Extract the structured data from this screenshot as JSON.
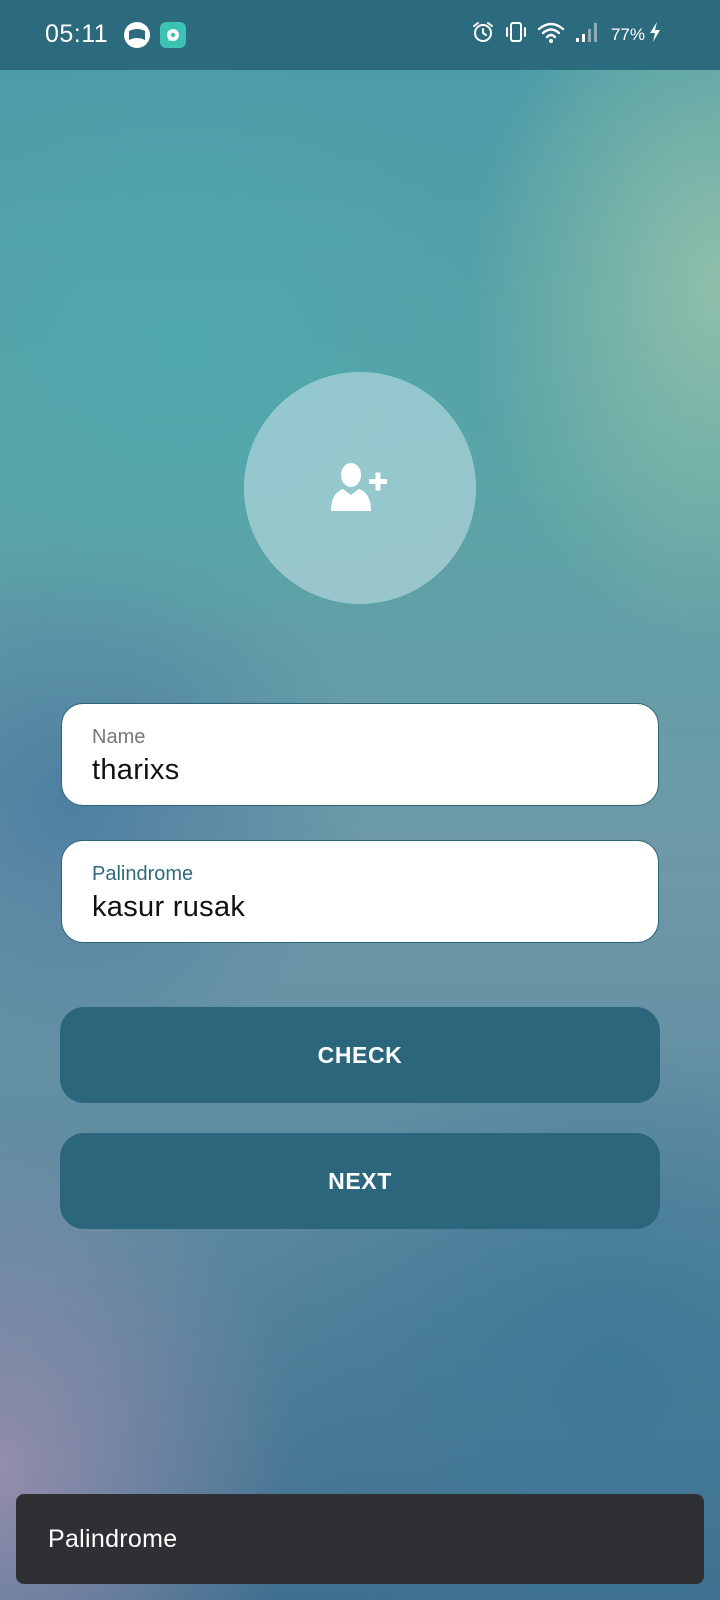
{
  "status_bar": {
    "time": "05:11",
    "battery": "77%",
    "left_icons": [
      "mail-app-icon",
      "chat-app-icon"
    ],
    "right_icons": [
      "alarm-icon",
      "vibrate-icon",
      "wifi-icon",
      "signal-icon",
      "charging-icon"
    ]
  },
  "avatar": {
    "icon": "add-user-icon"
  },
  "form": {
    "name_label": "Name",
    "name_value": "tharixs",
    "palindrome_label": "Palindrome",
    "palindrome_value": "kasur rusak"
  },
  "buttons": {
    "check_label": "CHECK",
    "next_label": "NEXT"
  },
  "snackbar": {
    "message": "Palindrome"
  },
  "colors": {
    "status_bar": "#2c6a7e",
    "button": "#2c667c",
    "field_border": "#2c6478",
    "focused_label": "#2e6a7e",
    "snackbar": "#2f3034"
  }
}
